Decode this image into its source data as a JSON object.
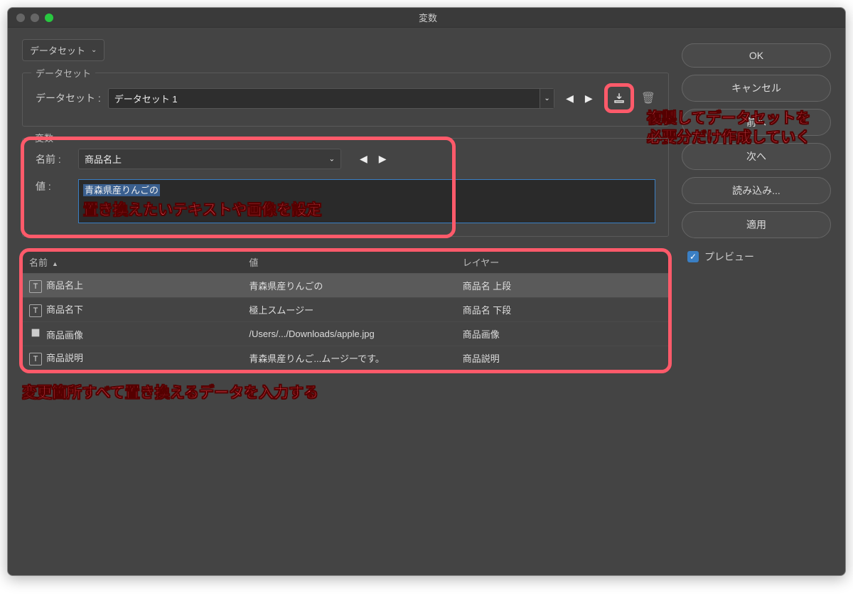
{
  "window_title": "変数",
  "dropdown_top": "データセット",
  "fieldset": {
    "legend": "データセット",
    "label": "データセット :",
    "value": "データセット 1"
  },
  "var_section": {
    "legend": "変数",
    "name_label": "名前 :",
    "name_value": "商品名上",
    "value_label": "値 :",
    "value_text": "青森県産りんごの"
  },
  "table": {
    "cols": {
      "name": "名前",
      "value": "値",
      "layer": "レイヤー"
    },
    "rows": [
      {
        "icon": "T",
        "name": "商品名上",
        "value": "青森県産りんごの",
        "layer": "商品名 上段"
      },
      {
        "icon": "T",
        "name": "商品名下",
        "value": "極上スムージー",
        "layer": "商品名 下段"
      },
      {
        "icon": "img",
        "name": "商品画像",
        "value": "/Users/.../Downloads/apple.jpg",
        "layer": "商品画像"
      },
      {
        "icon": "T",
        "name": "商品説明",
        "value": "青森県産りんご...ムージーです。",
        "layer": "商品説明"
      }
    ]
  },
  "annotations": {
    "a1": "置き換えたいテキストや画像を設定",
    "a2_l1": "複製してデータセットを",
    "a2_l2": "必要分だけ作成していく",
    "a3": "変更箇所すべて置き換えるデータを入力する"
  },
  "buttons": {
    "ok": "OK",
    "cancel": "キャンセル",
    "prev": "前へ",
    "next": "次へ",
    "load": "読み込み...",
    "apply": "適用",
    "preview": "プレビュー"
  }
}
